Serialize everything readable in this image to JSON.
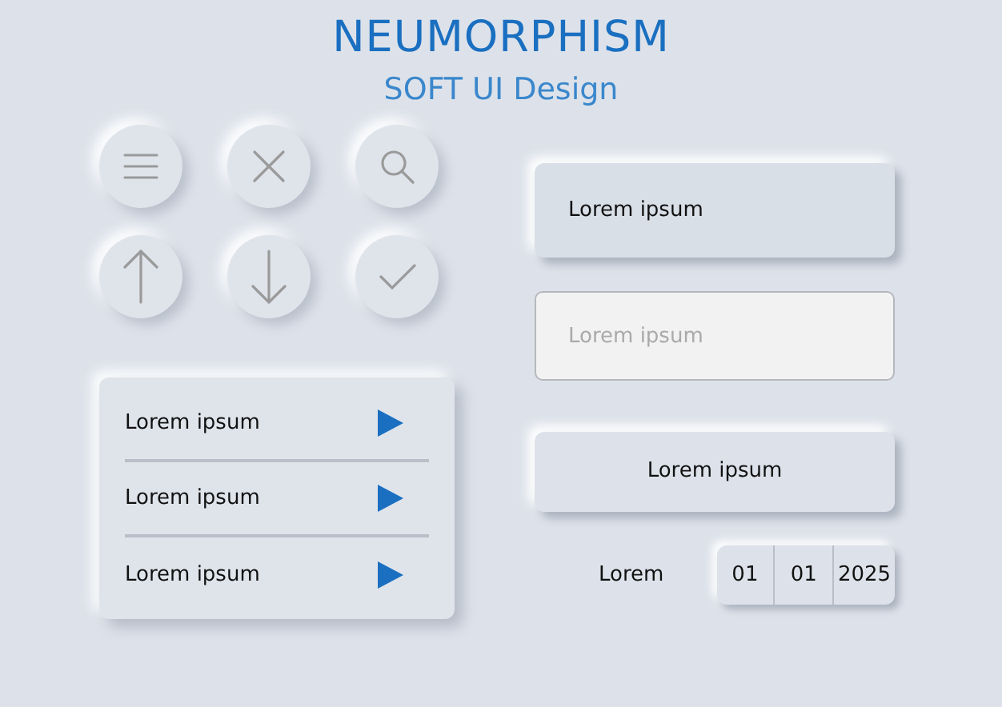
{
  "title": "NEUMORPHISM",
  "subtitle": "SOFT UI Design",
  "icon_buttons": [
    {
      "kind": "menu"
    },
    {
      "kind": "close"
    },
    {
      "kind": "search"
    },
    {
      "kind": "up"
    },
    {
      "kind": "down"
    },
    {
      "kind": "check"
    }
  ],
  "list": [
    {
      "label": "Lorem ipsum"
    },
    {
      "label": "Lorem ipsum"
    },
    {
      "label": "Lorem ipsum"
    }
  ],
  "text_box": {
    "value": "Lorem ipsum"
  },
  "input": {
    "placeholder": "Lorem ipsum"
  },
  "button": {
    "label": "Lorem ipsum"
  },
  "date": {
    "label": "Lorem",
    "parts": [
      "01",
      "01",
      "2025"
    ]
  }
}
